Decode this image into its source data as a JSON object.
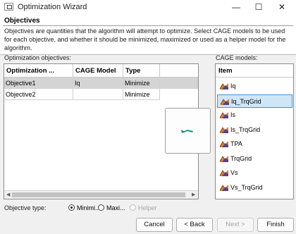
{
  "window": {
    "title": "Optimization Wizard",
    "minimize_glyph": "—",
    "maximize_glyph": "☐",
    "close_glyph": "✕"
  },
  "header": {
    "title": "Objectives",
    "description": "Objectives are quantities that the algorithm will attempt to optimize.  Select CAGE models to be used for each objective, and whether it should be minimized, maximized or used as a helper model for the algorithm."
  },
  "objectives": {
    "label": "Optimization objectives:",
    "columns": [
      "Optimization ...",
      "CAGE Model",
      "Type"
    ],
    "rows": [
      {
        "name": "Objective1",
        "model": "Iq",
        "type": "Minimize"
      },
      {
        "name": "Objective2",
        "model": "",
        "type": "Minimize"
      }
    ],
    "selected_row": 0
  },
  "models": {
    "label": "CAGE models:",
    "header": "Item",
    "items": [
      "Iq",
      "Iq_TrqGrid",
      "Is",
      "Is_TrqGrid",
      "TPA",
      "TrqGrid",
      "Vs",
      "Vs_TrqGrid"
    ],
    "selected_index": 1
  },
  "objective_type": {
    "label": "Objective type:",
    "options": [
      {
        "label": "Minimi...",
        "selected": true,
        "enabled": true
      },
      {
        "label": "Maxi...",
        "selected": false,
        "enabled": true
      },
      {
        "label": "Helper",
        "selected": false,
        "enabled": false
      }
    ]
  },
  "buttons": {
    "cancel": "Cancel",
    "back": "< Back",
    "next": "Next >",
    "finish": "Finish"
  },
  "colors": {
    "selection_fill": "#cfe6f7",
    "selection_border": "#3f93d6",
    "arrow_teal": "#1f8f8f"
  }
}
